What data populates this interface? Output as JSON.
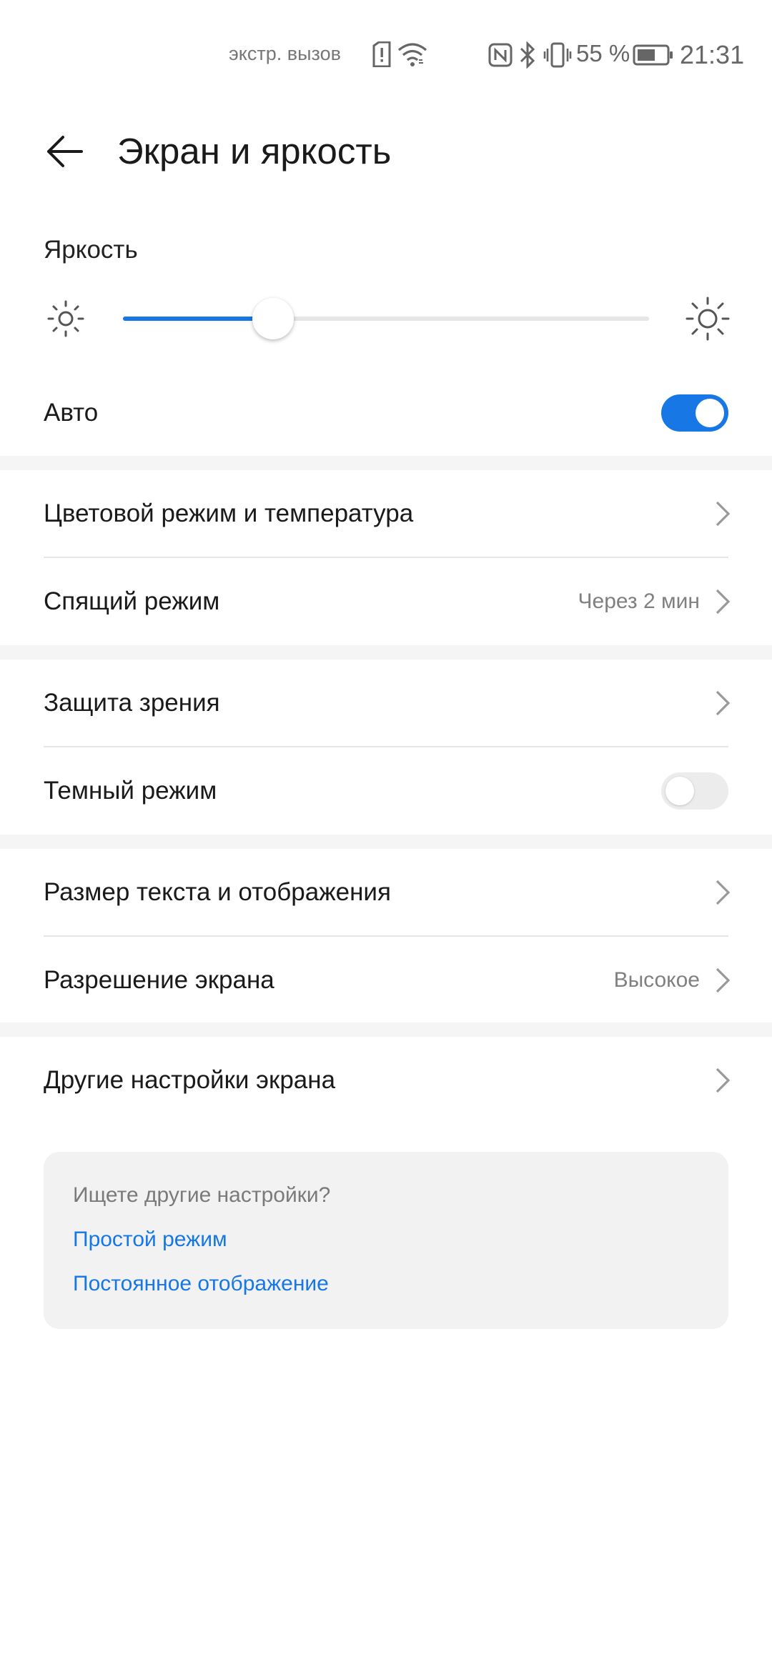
{
  "status_bar": {
    "emergency_text": "экстр. вызов",
    "battery_percent": "55 %",
    "time": "21:31",
    "icons": [
      "sim-alert-icon",
      "wifi-icon",
      "nfc-icon",
      "bluetooth-icon",
      "vibrate-icon",
      "battery-icon"
    ]
  },
  "header": {
    "title": "Экран и яркость",
    "back_icon": "arrow-left-icon"
  },
  "brightness": {
    "label": "Яркость",
    "level": 0.285,
    "auto_label": "Авто",
    "auto_enabled": true
  },
  "rows": {
    "color_mode": {
      "label": "Цветовой режим и температура"
    },
    "sleep": {
      "label": "Спящий режим",
      "value": "Через 2 мин"
    },
    "eye_comfort": {
      "label": "Защита зрения"
    },
    "dark_mode": {
      "label": "Темный режим",
      "enabled": false
    },
    "text_size": {
      "label": "Размер текста и отображения"
    },
    "resolution": {
      "label": "Разрешение экрана",
      "value": "Высокое"
    },
    "more_settings": {
      "label": "Другие настройки экрана"
    }
  },
  "suggestions": {
    "title": "Ищете другие настройки?",
    "links": [
      "Простой режим",
      "Постоянное отображение"
    ]
  },
  "colors": {
    "accent": "#1677e5",
    "divider": "#e6e6e6",
    "section_gap": "#f5f5f5",
    "card_bg": "#f2f2f2"
  }
}
